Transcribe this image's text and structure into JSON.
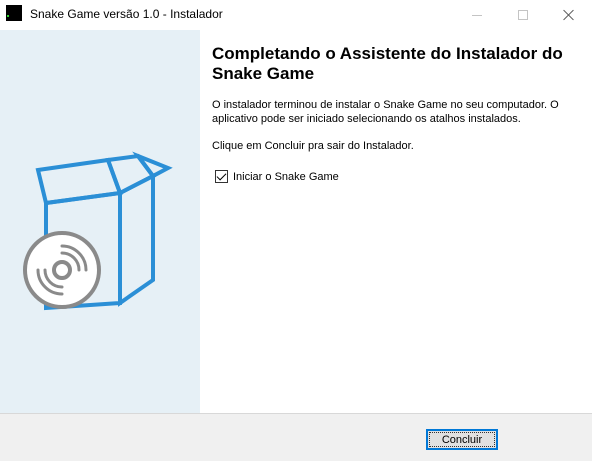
{
  "window": {
    "title": "Snake Game versão 1.0 - Instalador",
    "app_icon": "snake-game-icon"
  },
  "window_controls": {
    "minimize_icon": "minimize-icon",
    "maximize_icon": "maximize-icon",
    "close_icon": "close-icon"
  },
  "sidebar": {
    "illustration": "installer-box-disc-icon",
    "colors": {
      "background": "#e6f0f6",
      "box_stroke": "#2b8fd6",
      "disc_stroke": "#8a8a8a"
    }
  },
  "content": {
    "heading": "Completando o Assistente do Instalador do Snake Game",
    "body": "O instalador terminou de instalar o Snake Game no seu computador. O aplicativo pode ser iniciado selecionando os atalhos instalados.",
    "exit_instruction": "Clique em Concluir pra sair do Instalador.",
    "launch_checkbox": {
      "label": "Iniciar o Snake Game",
      "checked": true
    }
  },
  "footer": {
    "finish_label": "Concluir",
    "accent_color": "#0078d7"
  }
}
